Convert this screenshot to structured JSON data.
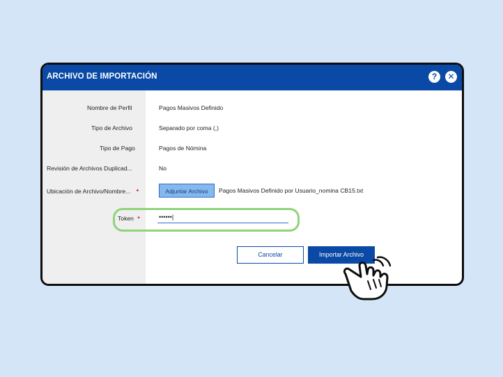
{
  "dialog": {
    "title": "ARCHIVO DE IMPORTACIÓN",
    "help_icon": "?",
    "close_icon": "✕"
  },
  "form": {
    "rows": [
      {
        "label": "Nombre de Perfil",
        "value": "Pagos Masivos Definido"
      },
      {
        "label": "Tipo de Archivo",
        "value": "Separado por coma (,)"
      },
      {
        "label": "Tipo de Pago",
        "value": "Pagos de Nómina"
      },
      {
        "label": "Revisión de Archivos Duplicad...",
        "value": "No"
      }
    ],
    "file_location": {
      "label": "Ubicación de Archivo/Nombre...",
      "required_mark": "*",
      "upload_button": "Adjuntar Archivo",
      "file_name": "Pagos Masivos Definido por Usuario_nomina CB15.txt"
    },
    "token": {
      "label": "Token",
      "required_mark": "*",
      "value": "••••••|"
    }
  },
  "actions": {
    "cancel_label": "Cancelar",
    "import_label": "Importar Archivo"
  },
  "colors": {
    "primary": "#0a4aa6",
    "highlight": "#8fd37a",
    "required": "#d0102a",
    "background": "#d4e5f7"
  },
  "icons": {
    "pointer": "hand-pointer-icon"
  }
}
